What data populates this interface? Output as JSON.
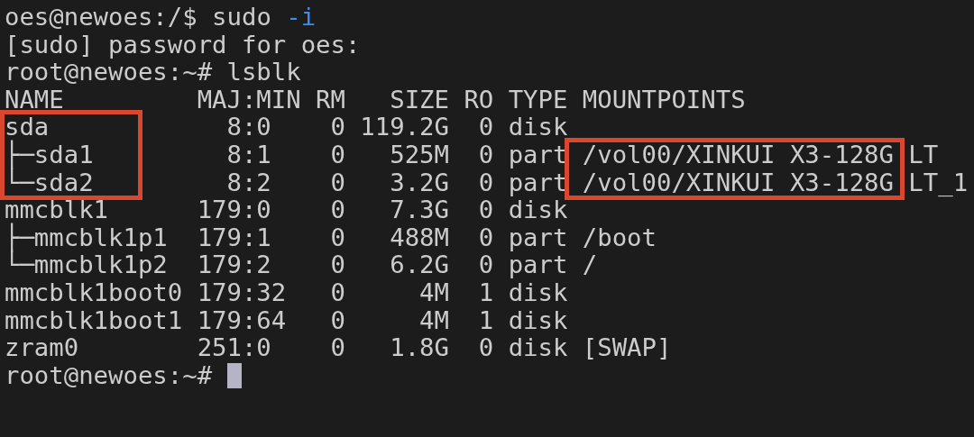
{
  "terminal": {
    "lines": [
      {
        "kind": "command",
        "prompt": "oes@newoes:/$",
        "command": "sudo",
        "option": "-i"
      },
      {
        "kind": "output",
        "text": "[sudo] password for oes:"
      },
      {
        "kind": "command",
        "prompt": "root@newoes:~#",
        "command": "lsblk"
      }
    ],
    "table": {
      "columns": [
        "NAME",
        "MAJ:MIN",
        "RM",
        "SIZE",
        "RO",
        "TYPE",
        "MOUNTPOINTS"
      ],
      "rows": [
        {
          "name": "sda",
          "majmin": "8:0",
          "rm": "0",
          "size": "119.2G",
          "ro": "0",
          "type": "disk",
          "name_highlighted": true,
          "mount_highlighted": false
        },
        {
          "name": "├─sda1",
          "majmin": "8:1",
          "rm": "0",
          "size": "525M",
          "ro": "0",
          "type": "part",
          "mountpoint": "/vol00/XINKUI X3-128G LT",
          "name_highlighted": true,
          "mount_highlighted": true
        },
        {
          "name": "└─sda2",
          "majmin": "8:2",
          "rm": "0",
          "size": "3.2G",
          "ro": "0",
          "type": "part",
          "mountpoint": "/vol00/XINKUI X3-128G LT_1",
          "name_highlighted": true,
          "mount_highlighted": true
        },
        {
          "name": "mmcblk1",
          "majmin": "179:0",
          "rm": "0",
          "size": "7.3G",
          "ro": "0",
          "type": "disk",
          "name_highlighted": false,
          "mount_highlighted": false
        },
        {
          "name": "├─mmcblk1p1",
          "majmin": "179:1",
          "rm": "0",
          "size": "488M",
          "ro": "0",
          "type": "part",
          "mountpoint": "/boot",
          "name_highlighted": false,
          "mount_highlighted": false
        },
        {
          "name": "└─mmcblk1p2",
          "majmin": "179:2",
          "rm": "0",
          "size": "6.2G",
          "ro": "0",
          "type": "part",
          "mountpoint": "/",
          "name_highlighted": false,
          "mount_highlighted": false
        },
        {
          "name": "mmcblk1boot0",
          "majmin": "179:32",
          "rm": "0",
          "size": "4M",
          "ro": "1",
          "type": "disk",
          "name_highlighted": false,
          "mount_highlighted": false
        },
        {
          "name": "mmcblk1boot1",
          "majmin": "179:64",
          "rm": "0",
          "size": "4M",
          "ro": "1",
          "type": "disk",
          "name_highlighted": false,
          "mount_highlighted": false
        },
        {
          "name": "zram0",
          "majmin": "251:0",
          "rm": "0",
          "size": "1.8G",
          "ro": "0",
          "type": "disk",
          "mountpoint": "[SWAP]",
          "name_highlighted": false,
          "mount_highlighted": false
        }
      ]
    },
    "final_prompt": "root@newoes:~#"
  }
}
